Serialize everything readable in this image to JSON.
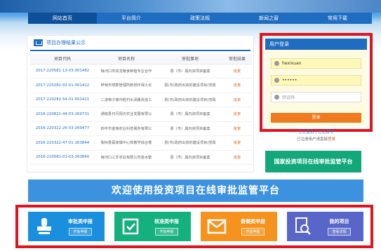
{
  "nav": {
    "items": [
      {
        "label": "网站首页",
        "active": true
      },
      {
        "label": "平台简介",
        "active": false
      },
      {
        "label": "政策法规",
        "active": false
      },
      {
        "label": "新闻之窗",
        "active": false
      },
      {
        "label": "常用下载",
        "active": false
      }
    ]
  },
  "results": {
    "title": "项目办理结果公示",
    "columns": [
      "项目代码",
      "项目名称",
      "审批事项",
      "审批结果"
    ],
    "rows": [
      {
        "code": "2017-220581-13-03-001482",
        "name": "梅河口市双龙粮食种植专业合作",
        "item": "县（市）属内资项目备案",
        "result": "批复"
      },
      {
        "code": "2017-220282-93-01-001422",
        "name": "桦甸市殡葬管理所新增环保火化",
        "item": "县(市)政府出资的建设项目(党政",
        "result": "批复"
      },
      {
        "code": "2017-220282-54-01-001411",
        "name": "二道甸子镇中胜村水泥路改造工",
        "item": "县(市)政府出资的建设项目(党政",
        "result": "批复"
      },
      {
        "code": "2016-220821-44-03-269731",
        "name": "通榆县日月阳光农业发展有限公",
        "item": "县（市）属内资项目备案",
        "result": "批复"
      },
      {
        "code": "2016-220322-26-03-269477",
        "name": "四平市金瑞农业科技服务有限公",
        "item": "县（市）属内资项目备案",
        "result": "批复"
      },
      {
        "code": "2016-220322-47-01-263844",
        "name": "梨树县蔡家镇中心校教学综合楼",
        "item": "县(市)政府出资的建设项目(党政",
        "result": "批复"
      },
      {
        "code": "2016-220581-01-03-263840",
        "name": "梅河口三羊农业有限公司苗木繁",
        "item": "县（市）属内资项目备案",
        "result": "批复"
      }
    ]
  },
  "login": {
    "title": "用户登录",
    "username": "hexixuan",
    "password": "••••••",
    "captcha_placeholder": "验证码",
    "button": "登录",
    "links": "忘记密码 | 忘记账号",
    "note": "已注册用户请直接",
    "note_link": "登录"
  },
  "promo": {
    "label": "国家投资项目在线审批监管平台"
  },
  "welcome": {
    "text": "欢迎使用投资项目在线审批监管平台"
  },
  "tiles": [
    {
      "title": "审批类申报",
      "button": "开始申报",
      "color": "#1a8fe0",
      "icon": "stamp-icon"
    },
    {
      "title": "核准类申报",
      "button": "开始申报",
      "color": "#14b07d",
      "icon": "checkbox-icon"
    },
    {
      "title": "备案类申报",
      "button": "开始申报",
      "color": "#f6921e",
      "icon": "mail-icon"
    },
    {
      "title": "我的项目",
      "button": "查看详情",
      "color": "#5866c9",
      "icon": "search-doc-icon"
    }
  ]
}
